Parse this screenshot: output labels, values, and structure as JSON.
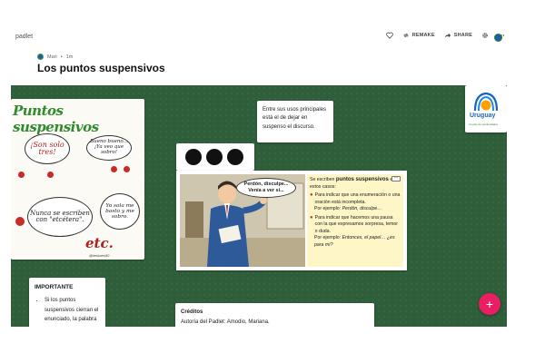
{
  "header": {
    "brand": "padlet",
    "actions": {
      "remake_label": "REMAKE",
      "share_label": "SHARE"
    }
  },
  "author": {
    "name": "Mari",
    "separator": "•",
    "time": "1m"
  },
  "page_title": "Los puntos suspensivos",
  "cards": {
    "comic": {
      "heading": "Puntos suspensivos",
      "bubble_1": "¡Son solo tres!",
      "bubble_2": "Bueno bueno... ¡Ya veo que sobro!",
      "bubble_3": "Nunca se escriben con \"etcétera\".",
      "bubble_4": "Yo sola me basto y me sobro.",
      "etc": "etc.",
      "signature": "@lenkaes90"
    },
    "text_1": {
      "body": "Entre sus usos principales está el de dejar en suspenso el discurso."
    },
    "logo": {
      "word": "Uruguay",
      "slogan": "Un país de oportunidades"
    },
    "scene": {
      "speech": "Perdón, disculpe... Venía a ver si...",
      "info_intro": "Se escriben",
      "info_bold": "puntos suspensivos",
      "info_tail": "en estos casos:",
      "item_1": "Para indicar que una enumeración o una oración está incompleta.",
      "item_1_ex_lead": "Por ejemplo:",
      "item_1_ex": "Perdón, disculpe…",
      "item_2": "Para indicar que hacemos una pausa con la que expresamos sorpresa, temor o duda.",
      "item_2_ex_lead": "Por ejemplo:",
      "item_2_ex": "Entonces, el papel… ¿es para mí?",
      "menu": "···"
    },
    "importante": {
      "title": "IMPORTANTE",
      "item": "Si los puntos suspensivos cierran el enunciado, la palabra"
    },
    "creditos": {
      "title": "Créditos",
      "body": "Autoría del Padlet: Amodio, Mariana."
    }
  },
  "fab": "+",
  "colors": {
    "board": "#2f5f3a",
    "fab": "#e91e63",
    "info_bg": "#fff6c8"
  }
}
